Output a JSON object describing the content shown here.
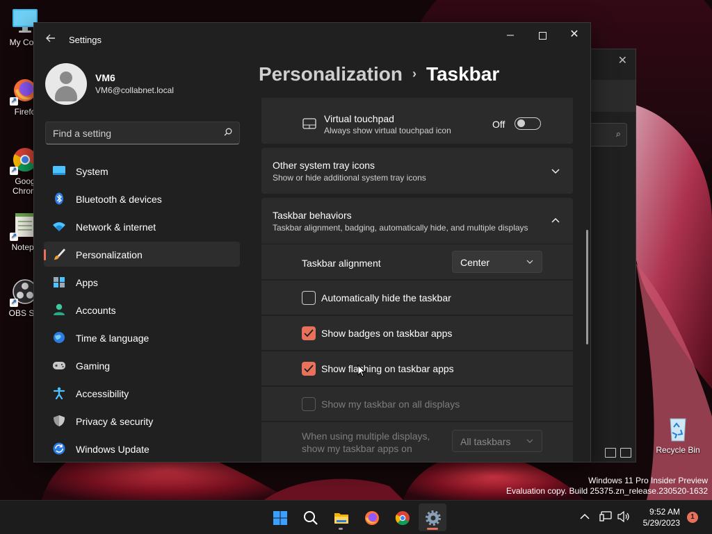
{
  "desktop": {
    "icons": [
      {
        "label": "My Com",
        "icon": "monitor-icon"
      },
      {
        "label": "Firefo",
        "icon": "firefox-icon"
      },
      {
        "label": "Goog",
        "label2": "Chrom",
        "icon": "chrome-icon"
      },
      {
        "label": "Notepa",
        "icon": "notepad-icon"
      },
      {
        "label": "OBS Stu",
        "icon": "obs-icon"
      },
      {
        "label": "Recycle Bin",
        "icon": "recycle-bin-icon"
      }
    ]
  },
  "settings": {
    "app_title": "Settings",
    "user": {
      "name": "VM6",
      "email": "VM6@collabnet.local"
    },
    "search_placeholder": "Find a setting",
    "nav": [
      {
        "label": "System",
        "icon": "system-icon"
      },
      {
        "label": "Bluetooth & devices",
        "icon": "bluetooth-icon"
      },
      {
        "label": "Network & internet",
        "icon": "network-icon"
      },
      {
        "label": "Personalization",
        "icon": "brush-icon",
        "active": true
      },
      {
        "label": "Apps",
        "icon": "apps-icon"
      },
      {
        "label": "Accounts",
        "icon": "accounts-icon"
      },
      {
        "label": "Time & language",
        "icon": "globe-icon"
      },
      {
        "label": "Gaming",
        "icon": "gamepad-icon"
      },
      {
        "label": "Accessibility",
        "icon": "accessibility-icon"
      },
      {
        "label": "Privacy & security",
        "icon": "shield-icon"
      },
      {
        "label": "Windows Update",
        "icon": "update-icon"
      }
    ],
    "breadcrumb": {
      "parent": "Personalization",
      "separator": "›",
      "current": "Taskbar"
    },
    "virtual_touchpad": {
      "title": "Virtual touchpad",
      "subtitle": "Always show virtual touchpad icon",
      "state": "Off"
    },
    "other_tray": {
      "title": "Other system tray icons",
      "subtitle": "Show or hide additional system tray icons"
    },
    "behaviors": {
      "title": "Taskbar behaviors",
      "subtitle": "Taskbar alignment, badging, automatically hide, and multiple displays",
      "alignment_label": "Taskbar alignment",
      "alignment_value": "Center",
      "auto_hide": "Automatically hide the taskbar",
      "badges": "Show badges on taskbar apps",
      "flashing": "Show flashing on taskbar apps",
      "all_displays": "Show my taskbar on all displays",
      "multi_display_line1": "When using multiple displays,",
      "multi_display_line2": "show my taskbar apps on",
      "multi_display_value": "All taskbars"
    },
    "checks": {
      "auto_hide": false,
      "badges": true,
      "flashing": true,
      "all_displays": false
    }
  },
  "watermark": {
    "line1": "Windows 11 Pro Insider Preview",
    "line2": "Evaluation copy. Build 25375.zn_release.230520-1632"
  },
  "taskbar": {
    "apps": [
      "start-icon",
      "search-icon",
      "file-explorer-icon",
      "firefox-icon",
      "chrome-icon",
      "settings-icon"
    ],
    "time": "9:52 AM",
    "date": "5/29/2023",
    "notification_count": "1"
  },
  "colors": {
    "accent": "#e8715c",
    "window_bg": "#202020",
    "card_bg": "#2b2b2b"
  }
}
